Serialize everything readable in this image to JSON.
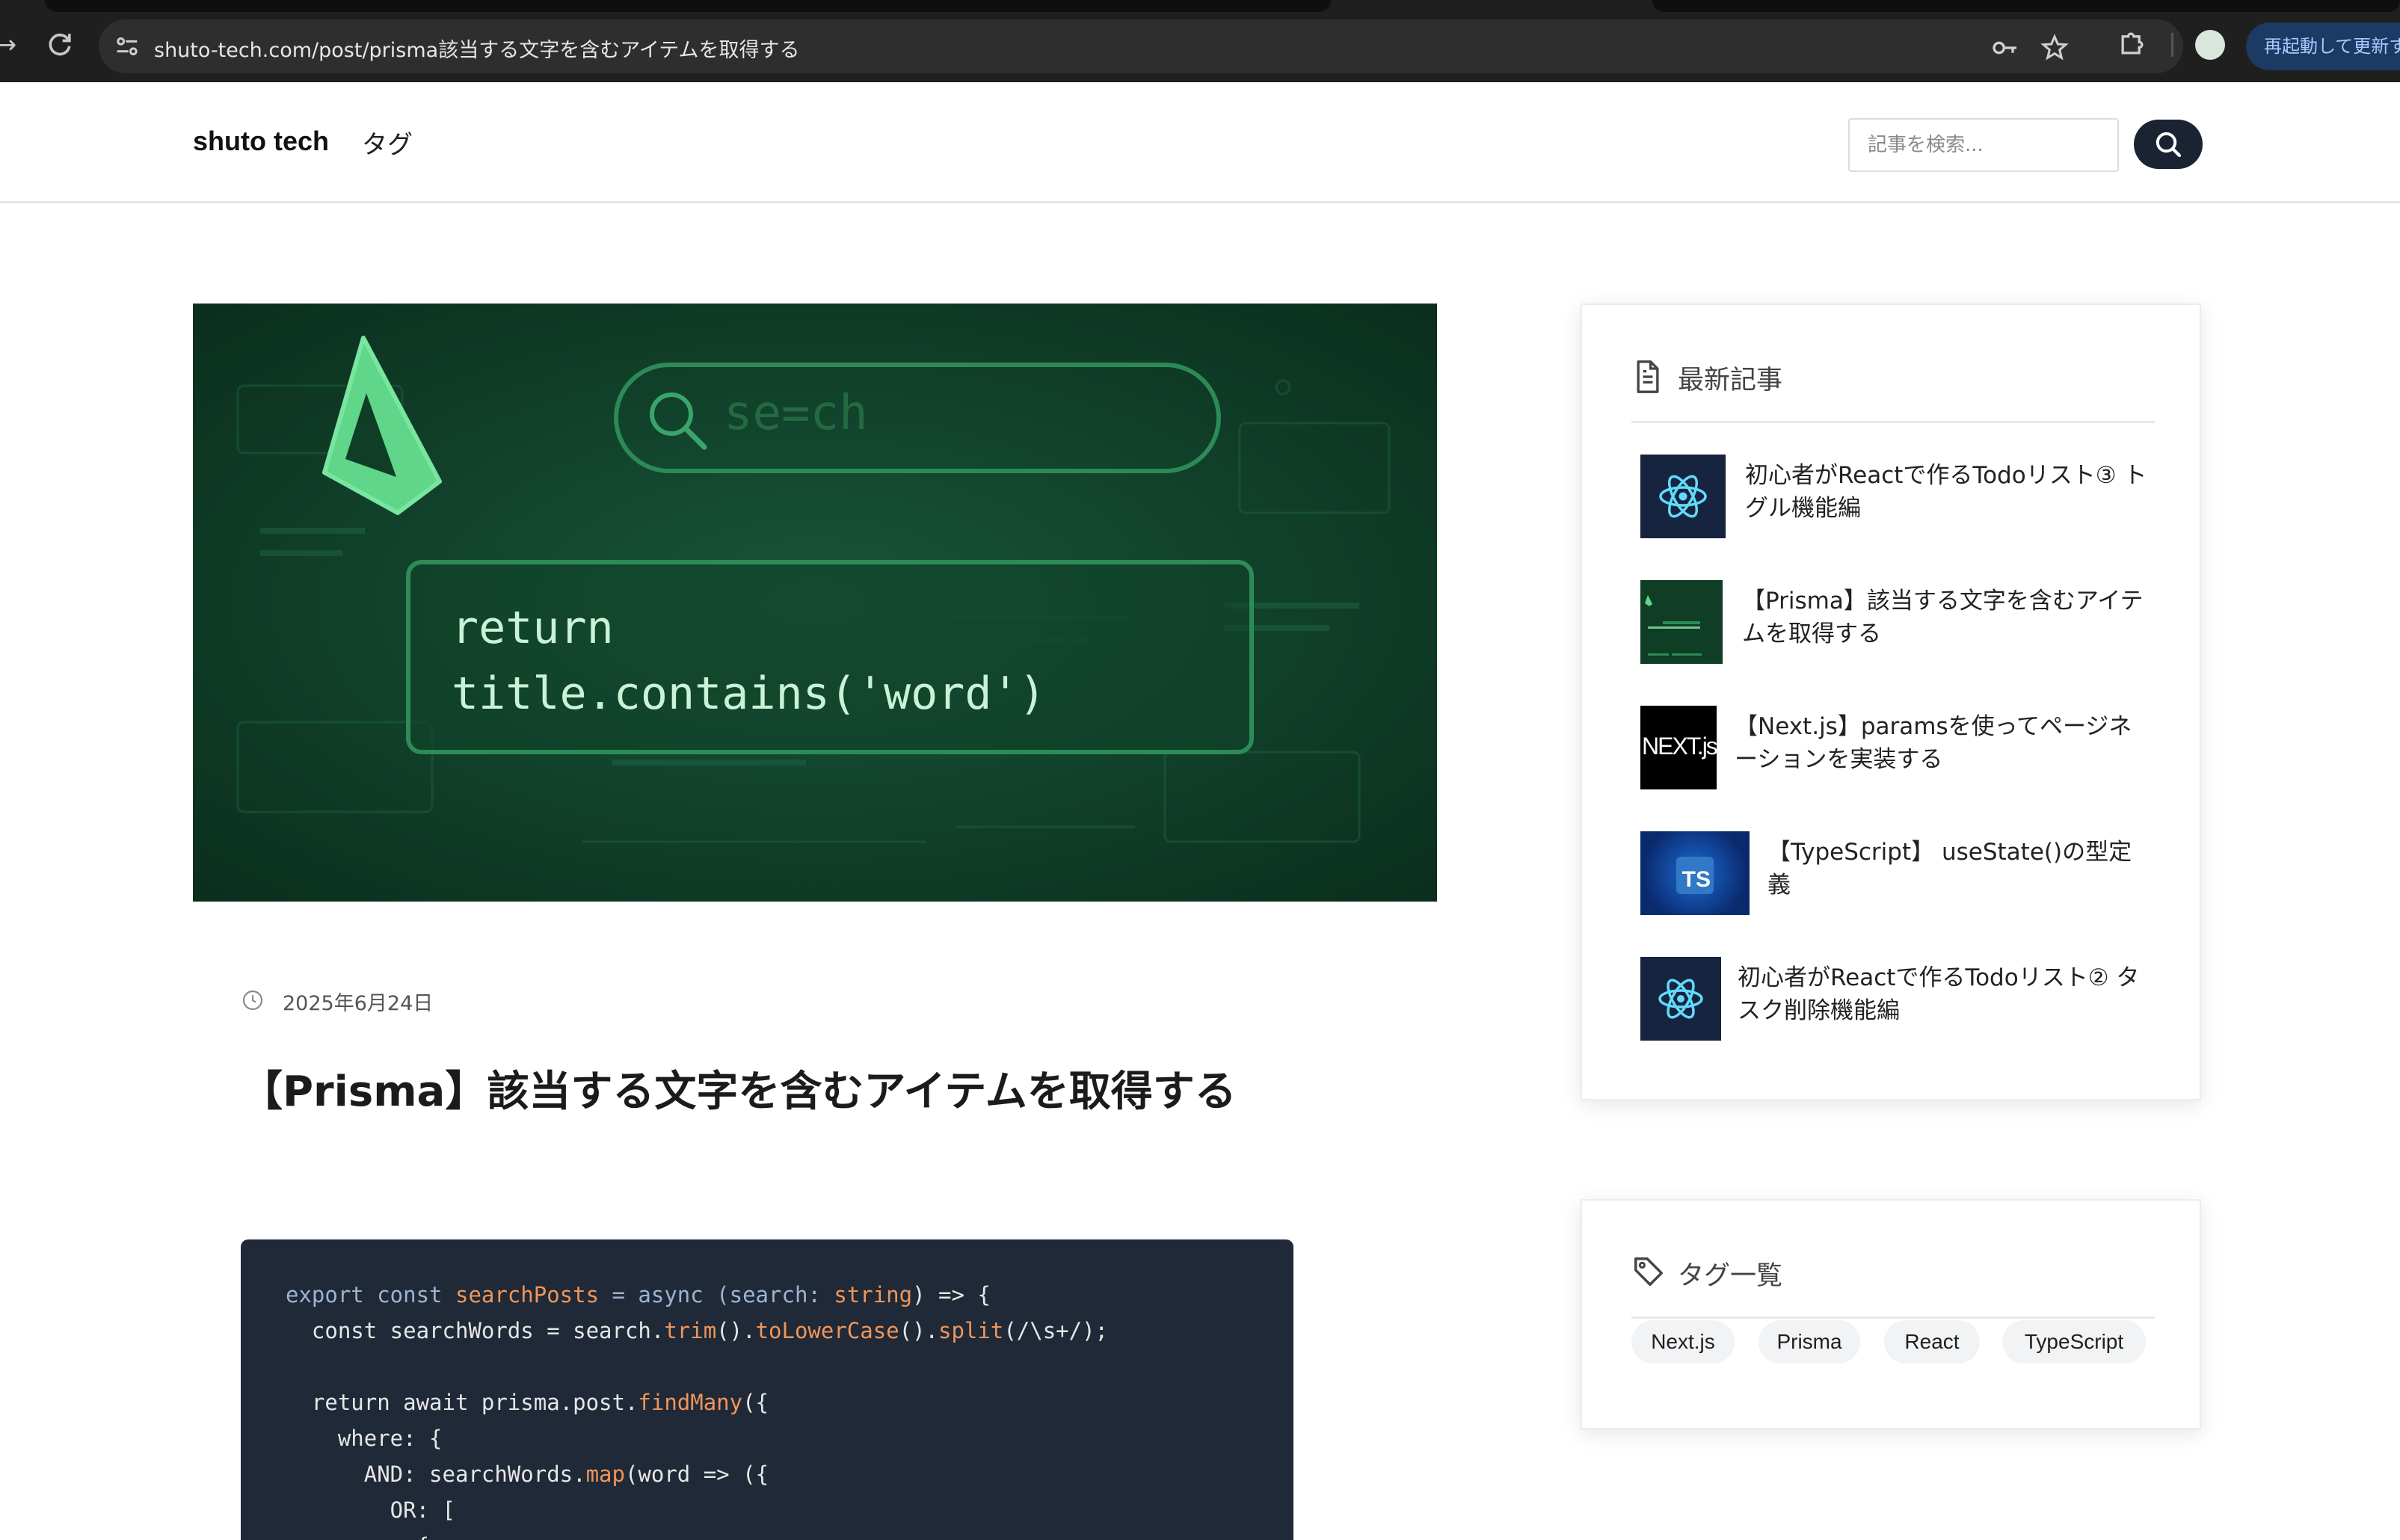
{
  "browser": {
    "url": "shuto-tech.com/post/prisma該当する文字を含むアイテムを取得する",
    "relaunch_label": "再起動して更新す"
  },
  "header": {
    "brand": "shuto tech",
    "nav_tag": "タグ",
    "search_placeholder": "記事を検索..."
  },
  "hero": {
    "search_text": "se=ch",
    "code_lines": "return\ntitle.contains('word')"
  },
  "article": {
    "date": "2025年6月24日",
    "title": "【Prisma】該当する文字を含むアイテムを取得する",
    "code": [
      [
        "export const ",
        "kw",
        "searchPosts",
        "fn",
        " = async (search: ",
        "kw",
        "string",
        "fn",
        ") => {",
        "t"
      ],
      [
        "  const searchWords = search.",
        "t",
        "trim",
        "fn",
        "().",
        "t",
        "toLowerCase",
        "fn",
        "().",
        "t",
        "split",
        "fn",
        "(/\\s+/);",
        "t"
      ],
      [
        "",
        "t"
      ],
      [
        "  return await prisma.post.",
        "t",
        "findMany",
        "fn",
        "({",
        "t"
      ],
      [
        "    where: {",
        "t"
      ],
      [
        "      AND: searchWords.",
        "t",
        "map",
        "fn",
        "(word => ({",
        "t"
      ],
      [
        "        OR: [",
        "t"
      ],
      [
        "          {",
        "t"
      ]
    ]
  },
  "sidebar": {
    "latest_title": "最新記事",
    "posts": [
      {
        "title": "初心者がReactで作るTodoリスト③ トグル機能編",
        "thumb": "react"
      },
      {
        "title": "【Prisma】該当する文字を含むアイテムを取得する",
        "thumb": "prisma"
      },
      {
        "title": "【Next.js】paramsを使ってページネーションを実装する",
        "thumb": "next",
        "thumb_text": "NEXT.js"
      },
      {
        "title": "【TypeScript】 useState()の型定義",
        "thumb": "ts",
        "thumb_text": "TS"
      },
      {
        "title": "初心者がReactで作るTodoリスト② タスク削除機能編",
        "thumb": "react"
      }
    ],
    "tags_title": "タグ一覧",
    "tags": [
      "Next.js",
      "Prisma",
      "React",
      "TypeScript"
    ]
  },
  "colors": {
    "accent_dark": "#1a2332",
    "code_bg": "#1f2937",
    "hero_green": "#0f3d26",
    "prisma_green": "#5fd68a"
  }
}
